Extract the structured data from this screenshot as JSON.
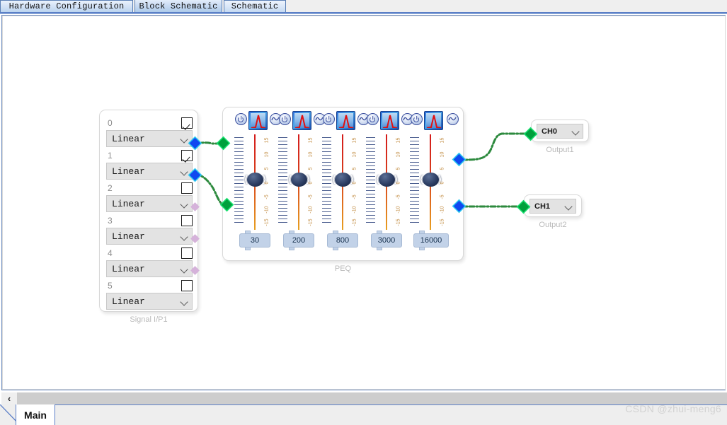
{
  "tabs": [
    {
      "label": "Hardware Configuration",
      "active": false
    },
    {
      "label": "Block Schematic",
      "active": true
    },
    {
      "label": "Schematic",
      "active": false
    }
  ],
  "signal_block": {
    "caption": "Signal I/P1",
    "channels": [
      {
        "index": "0",
        "checked": true,
        "mode": "Linear",
        "port_state": "connected"
      },
      {
        "index": "1",
        "checked": true,
        "mode": "Linear",
        "port_state": "connected"
      },
      {
        "index": "2",
        "checked": false,
        "mode": "Linear",
        "port_state": "idle"
      },
      {
        "index": "3",
        "checked": false,
        "mode": "Linear",
        "port_state": "idle"
      },
      {
        "index": "4",
        "checked": false,
        "mode": "Linear",
        "port_state": "idle"
      },
      {
        "index": "5",
        "checked": false,
        "mode": "Linear",
        "port_state": "idle"
      }
    ]
  },
  "peq_block": {
    "caption": "PEQ",
    "gain_scale_labels": [
      "15",
      "10",
      "5",
      "0",
      "-5",
      "-10",
      "-15"
    ],
    "bands": [
      {
        "frequency": "30",
        "power_icon": "power-icon",
        "curve_icon": "peak-filter-icon",
        "sine_icon": "sine-icon"
      },
      {
        "frequency": "200",
        "power_icon": "power-icon",
        "curve_icon": "peak-filter-icon",
        "sine_icon": "sine-icon"
      },
      {
        "frequency": "800",
        "power_icon": "power-icon",
        "curve_icon": "peak-filter-icon",
        "sine_icon": "sine-icon"
      },
      {
        "frequency": "3000",
        "power_icon": "power-icon",
        "curve_icon": "peak-filter-icon",
        "sine_icon": "sine-icon"
      },
      {
        "frequency": "16000",
        "power_icon": "power-icon",
        "curve_icon": "peak-filter-icon",
        "sine_icon": "sine-icon"
      }
    ]
  },
  "outputs": [
    {
      "caption": "Output1",
      "channel": "CH0"
    },
    {
      "caption": "Output2",
      "channel": "CH1"
    }
  ],
  "bottom": {
    "scroll_left_label": "‹",
    "main_tab": "Main"
  },
  "watermark": "CSDN @zhui-meng6",
  "colors": {
    "accent_blue": "#5b7fc7",
    "port_output": "#1048f0",
    "port_input": "#00a03c",
    "port_idle": "#d5b2da",
    "wire": "#2d8a3e",
    "band_line": "#d41b1b"
  }
}
